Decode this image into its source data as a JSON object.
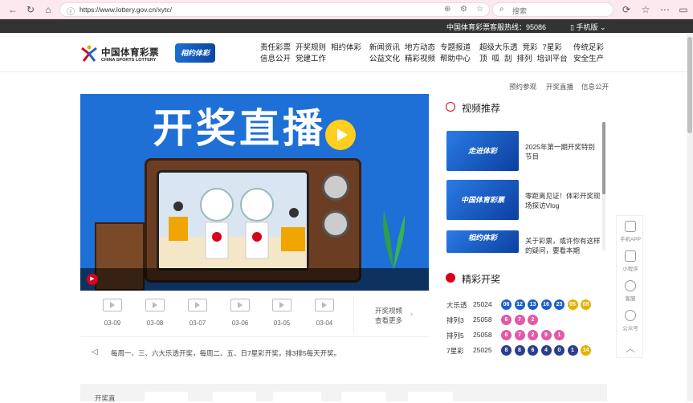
{
  "browser": {
    "url": "https://www.lottery.gov.cn/xytc/",
    "search_placeholder": "搜索"
  },
  "topbar": {
    "hotline": "中国体育彩票客服热线：95086",
    "mobile": "手机版"
  },
  "logo": {
    "cn": "中国体育彩票",
    "en": "CHINA SPORTS LOTTERY",
    "badge": "相约体彩"
  },
  "nav": {
    "col1": [
      "责任彩票",
      "开奖规则",
      "相约体彩"
    ],
    "col1b": [
      "信息公开",
      "党建工作"
    ],
    "col2": [
      "新闻资讯",
      "地方动态",
      "专题报道"
    ],
    "col2b": [
      "公益文化",
      "精彩视频",
      "帮助中心"
    ],
    "col3": [
      "超级大乐透",
      "竞彩",
      "7星彩"
    ],
    "col3b": [
      "顶",
      "呱",
      "刮",
      "排列",
      "培训平台"
    ],
    "col4": [
      "传统足彩",
      "安全生产"
    ]
  },
  "subnav": [
    "预约参观",
    "开奖直播",
    "信息公开"
  ],
  "banner": {
    "title": "开奖直播"
  },
  "thumbs": [
    "03-09",
    "03-08",
    "03-07",
    "03-06",
    "03-05",
    "03-04"
  ],
  "more_video": [
    "开奖视频",
    "查看更多"
  ],
  "notice": "每周一、三、六大乐透开奖，每周二、五、日7星彩开奖，排3排5每天开奖。",
  "video_section": {
    "title": "视频推荐",
    "items": [
      {
        "thumb": "走进体彩",
        "title": "2025年第一期开奖特别节目"
      },
      {
        "thumb": "中国体育彩票",
        "title": "零距离见证！体彩开奖现场探访Vlog"
      },
      {
        "thumb": "相约体彩",
        "title": "关于彩票，或许你有这样的疑问，要看本期"
      }
    ]
  },
  "lottery_section": {
    "title": "精彩开奖",
    "rows": [
      {
        "name": "大乐透",
        "period": "25024",
        "balls": [
          {
            "v": "06",
            "c": "#1e5fc9"
          },
          {
            "v": "12",
            "c": "#1e5fc9"
          },
          {
            "v": "13",
            "c": "#1e5fc9"
          },
          {
            "v": "16",
            "c": "#1e5fc9"
          },
          {
            "v": "23",
            "c": "#1e5fc9"
          },
          {
            "v": "05",
            "c": "#e3b200"
          },
          {
            "v": "08",
            "c": "#e3b200"
          }
        ]
      },
      {
        "name": "排列3",
        "period": "25058",
        "balls": [
          {
            "v": "6",
            "c": "#e05aa7"
          },
          {
            "v": "7",
            "c": "#e05aa7"
          },
          {
            "v": "2",
            "c": "#e05aa7"
          }
        ]
      },
      {
        "name": "排列5",
        "period": "25058",
        "balls": [
          {
            "v": "6",
            "c": "#e05aa7"
          },
          {
            "v": "7",
            "c": "#e05aa7"
          },
          {
            "v": "2",
            "c": "#e05aa7"
          },
          {
            "v": "9",
            "c": "#e05aa7"
          },
          {
            "v": "1",
            "c": "#e05aa7"
          }
        ]
      },
      {
        "name": "7星彩",
        "period": "25025",
        "balls": [
          {
            "v": "8",
            "c": "#2a3d8f"
          },
          {
            "v": "8",
            "c": "#2a3d8f"
          },
          {
            "v": "6",
            "c": "#2a3d8f"
          },
          {
            "v": "4",
            "c": "#2a3d8f"
          },
          {
            "v": "0",
            "c": "#2a3d8f"
          },
          {
            "v": "1",
            "c": "#2a3d8f"
          },
          {
            "v": "14",
            "c": "#e3b200"
          }
        ]
      }
    ]
  },
  "rightbar": [
    "手机APP",
    "小程序",
    "客服",
    "公众号"
  ],
  "footer": {
    "label": "开奖直"
  }
}
